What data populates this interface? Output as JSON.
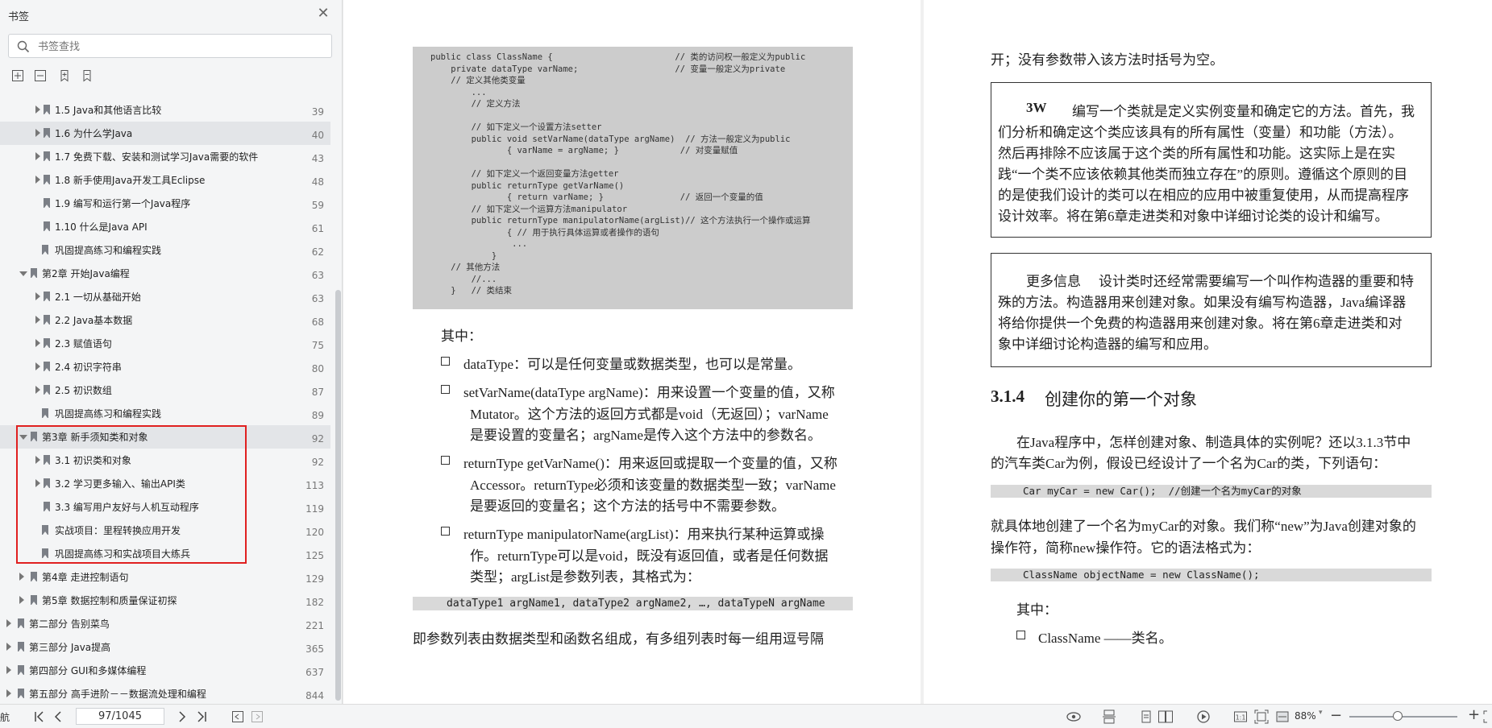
{
  "sidebar": {
    "title": "书签",
    "search_placeholder": "书签查找",
    "toc": [
      {
        "label": "1.5  Java和其他语言比较",
        "page": "39",
        "level": 2,
        "expandable": true,
        "hl": false
      },
      {
        "label": "1.6  为什么学Java",
        "page": "40",
        "level": 2,
        "expandable": true,
        "hl": true
      },
      {
        "label": "1.7  免费下载、安装和测试学习Java需要的软件",
        "page": "43",
        "level": 2,
        "expandable": true,
        "hl": false
      },
      {
        "label": "1.8  新手使用Java开发工具Eclipse",
        "page": "48",
        "level": 2,
        "expandable": true,
        "hl": false
      },
      {
        "label": "1.9  编写和运行第一个Java程序",
        "page": "59",
        "level": 2,
        "expandable": false,
        "hl": false
      },
      {
        "label": "1.10  什么是Java API",
        "page": "61",
        "level": 2,
        "expandable": false,
        "hl": false
      },
      {
        "label": "巩固提高练习和编程实践",
        "page": "62",
        "level": 1.5,
        "expandable": false,
        "hl": false
      },
      {
        "label": "第2章  开始Java编程",
        "page": "63",
        "level": 1,
        "expandable": true,
        "open": true,
        "hl": false
      },
      {
        "label": "2.1  一切从基础开始",
        "page": "63",
        "level": 2,
        "expandable": true,
        "hl": false
      },
      {
        "label": "2.2  Java基本数据",
        "page": "68",
        "level": 2,
        "expandable": true,
        "hl": false
      },
      {
        "label": "2.3  赋值语句",
        "page": "75",
        "level": 2,
        "expandable": true,
        "hl": false
      },
      {
        "label": "2.4  初识字符串",
        "page": "80",
        "level": 2,
        "expandable": true,
        "hl": false
      },
      {
        "label": "2.5  初识数组",
        "page": "87",
        "level": 2,
        "expandable": true,
        "hl": false
      },
      {
        "label": "巩固提高练习和编程实践",
        "page": "89",
        "level": 1.5,
        "expandable": false,
        "hl": false
      },
      {
        "label": "第3章  新手须知类和对象",
        "page": "92",
        "level": 1,
        "expandable": true,
        "open": true,
        "hl": true
      },
      {
        "label": "3.1  初识类和对象",
        "page": "92",
        "level": 2,
        "expandable": true,
        "hl": false
      },
      {
        "label": "3.2  学习更多输入、输出API类",
        "page": "113",
        "level": 2,
        "expandable": true,
        "hl": false
      },
      {
        "label": "3.3  编写用户友好与人机互动程序",
        "page": "119",
        "level": 2,
        "expandable": false,
        "hl": false
      },
      {
        "label": "实战项目：里程转换应用开发",
        "page": "120",
        "level": 1.5,
        "expandable": false,
        "hl": false
      },
      {
        "label": "巩固提高练习和实战项目大练兵",
        "page": "125",
        "level": 1.5,
        "expandable": false,
        "hl": false
      },
      {
        "label": "第4章  走进控制语句",
        "page": "129",
        "level": 1,
        "expandable": true,
        "hl": false
      },
      {
        "label": "第5章  数据控制和质量保证初探",
        "page": "182",
        "level": 1,
        "expandable": true,
        "hl": false
      },
      {
        "label": "第二部分  告别菜鸟",
        "page": "221",
        "level": 0,
        "expandable": true,
        "hl": false
      },
      {
        "label": "第三部分  Java提高",
        "page": "365",
        "level": 0,
        "expandable": true,
        "hl": false
      },
      {
        "label": "第四部分  GUI和多媒体编程",
        "page": "637",
        "level": 0,
        "expandable": true,
        "hl": false
      },
      {
        "label": "第五部分  高手进阶－－数据流处理和编程",
        "page": "844",
        "level": 0,
        "expandable": true,
        "hl": false
      }
    ]
  },
  "document": {
    "code_lines": [
      "public class ClassName {                        // 类的访问权一般定义为public",
      "    private dataType varName;                   // 变量一般定义为private",
      "    // 定义其他类变量",
      "        ...",
      "        // 定义方法",
      "",
      "        // 如下定义一个设置方法setter",
      "        public void setVarName(dataType argName)  // 方法一般定义为public",
      "               { varName = argName; }            // 对变量赋值",
      "",
      "        // 如下定义一个返回变量方法getter",
      "        public returnType getVarName()",
      "               { return varName; }               // 返回一个变量的值",
      "        // 如下定义一个运算方法manipulator",
      "        public returnType manipulatorName(argList)// 这个方法执行一个操作或运算",
      "               { // 用于执行具体运算或者操作的语句",
      "                ...",
      "            }",
      "    // 其他方法",
      "        //...",
      "    }   // 类结束"
    ],
    "left_text": {
      "qizhong": "其中：",
      "b1_l1": "dataType：可以是任何变量或数据类型，也可以是常量。",
      "b2_l1": "setVarName(dataType  argName)：用来设置一个变量的值，又称",
      "b2_l2": "Mutator。这个方法的返回方式都是void（无返回）；varName",
      "b2_l3": "是要设置的变量名；argName是传入这个方法中的参数名。",
      "b3_l1": "returnType getVarName()：用来返回或提取一个变量的值，又称",
      "b3_l2": "Accessor。returnType必须和该变量的数据类型一致；varName",
      "b3_l3": "是要返回的变量名；这个方法的括号中不需要参数。",
      "b4_l1": "returnType     manipulatorName(argList)：用来执行某种运算或操",
      "b4_l2": "作。returnType可以是void，既没有返回值，或者是任何数据",
      "b4_l3": "类型；argList是参数列表，其格式为：",
      "code_args": "dataType1 argName1, dataType2 argName2, …, dataTypeN argName",
      "last": "即参数列表由数据类型和函数名组成，有多组列表时每一组用逗号隔"
    },
    "right_text": {
      "top": "开；没有参数带入该方法时括号为空。",
      "box1_head": "3W",
      "box1_l1": "编写一个类就是定义实例变量和确定它的方法。首先，我",
      "box1_l2": "们分析和确定这个类应该具有的所有属性（变量）和功能（方法）。",
      "box1_l3": "然后再排除不应该属于这个类的所有属性和功能。这实际上是在实",
      "box1_l4": "践“一个类不应该依赖其他类而独立存在”的原则。遵循这个原则的目",
      "box1_l5": "的是使我们设计的类可以在相应的应用中被重复使用，从而提高程序",
      "box1_l6": "设计效率。将在第6章走进类和对象中详细讨论类的设计和编写。",
      "box2_head": "更多信息",
      "box2_l1": "设计类时还经常需要编写一个叫作构造器的重要和特",
      "box2_l2": "殊的方法。构造器用来创建对象。如果没有编写构造器，Java编译器",
      "box2_l3": "将给你提供一个免费的构造器用来创建对象。将在第6章走进类和对",
      "box2_l4": "象中详细讨论构造器的编写和应用。",
      "sec_num": "3.1.4",
      "sec_title": "创建你的第一个对象",
      "p1_l1": "在Java程序中，怎样创建对象、制造具体的实例呢？还以3.1.3节中",
      "p1_l2": "的汽车类Car为例，假设已经设计了一个名为Car的类，下列语句：",
      "code1": "Car myCar = new Car();  //创建一个名为myCar的对象",
      "p2_l1": "就具体地创建了一个名为myCar的对象。我们称“new”为Java创建对象的",
      "p2_l2": "操作符，简称new操作符。它的语法格式为：",
      "code2": "ClassName objectName = new ClassName();",
      "qizhong": "其中：",
      "b1": "ClassName ——类名。"
    }
  },
  "bottombar": {
    "nav_label": "航",
    "page_value": "97/1045",
    "zoom": "88%"
  }
}
